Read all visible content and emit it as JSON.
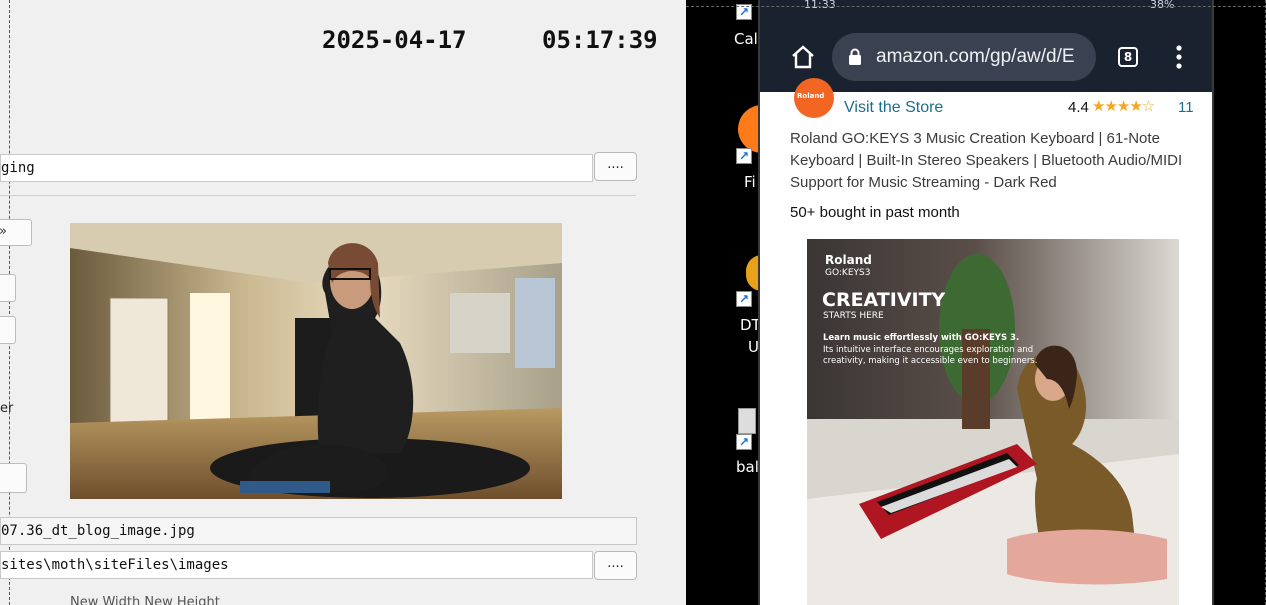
{
  "app": {
    "date": "2025-04-17",
    "time": "05:17:39",
    "field_top": "ging",
    "browse_label": "....",
    "cut_nav_label": "»",
    "cut_er_label": "er",
    "filename": "07.36_dt_blog_image.jpg",
    "folder": "sites\\moth\\siteFiles\\images",
    "dims_label": "New Width    New Height"
  },
  "desktop": {
    "icons": [
      {
        "label": "Cal"
      },
      {
        "label": "Fi"
      },
      {
        "label": "DT"
      },
      {
        "label": "U"
      },
      {
        "label": "bal"
      }
    ]
  },
  "phone": {
    "status_time": "11:33",
    "status_right": "38%",
    "url": "amazon.com/gp/aw/d/E",
    "tab_count": "8",
    "store_logo_text": "Roland",
    "visit_store": "Visit the Store",
    "rating": "4.4",
    "rating_count": "11",
    "title": "Roland GO:KEYS 3 Music Creation Keyboard | 61-Note Keyboard | Built-In Stereo Speakers | Bluetooth Audio/MIDI Support for Music Streaming - Dark Red",
    "bought": "50+ bought in past month",
    "ad": {
      "brand": "Roland",
      "model": "GO:KEYS3",
      "headline": "CREATIVITY",
      "subhead": "STARTS HERE",
      "copy_bold": "Learn music effortlessly with GO:KEYS 3.",
      "copy": "Its intuitive interface encourages exploration and creativity, making it accessible even to beginners."
    }
  },
  "colors": {
    "amazon_link": "#1a6e8c",
    "star": "#f5a623",
    "roland_orange": "#f26522"
  }
}
